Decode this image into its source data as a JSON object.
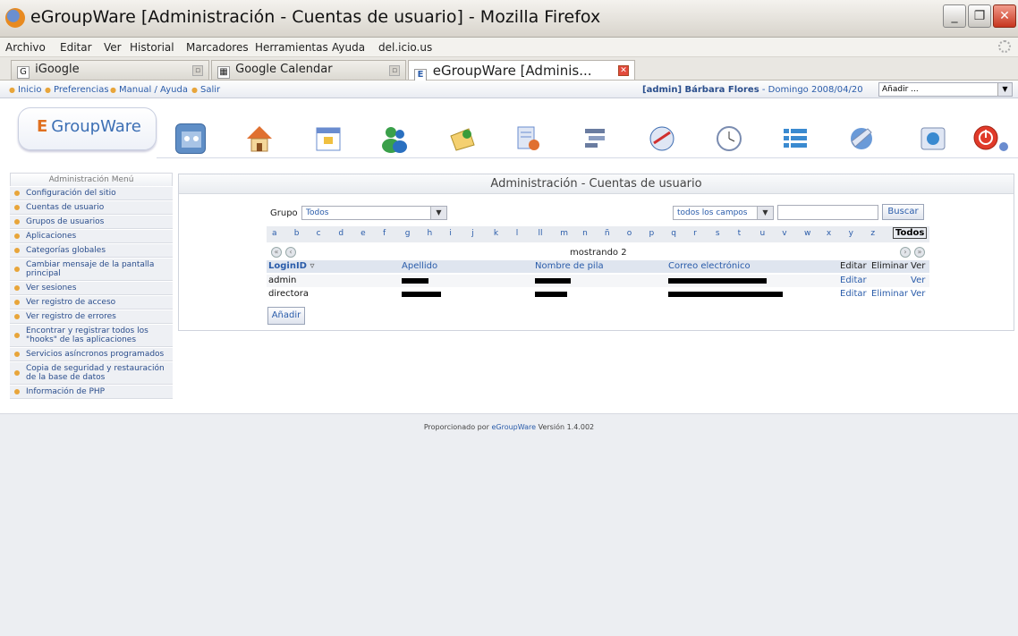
{
  "window": {
    "title": "eGroupWare [Administración - Cuentas de usuario] - Mozilla Firefox",
    "min_icon": "minimize-icon",
    "max_icon": "maximize-icon",
    "close_icon": "close-icon"
  },
  "menubar": {
    "items": [
      "Archivo",
      "Editar",
      "Ver",
      "Historial",
      "Marcadores",
      "Herramientas",
      "Ayuda",
      "del.icio.us"
    ]
  },
  "tabs": [
    {
      "label": "iGoogle",
      "favicon": "G"
    },
    {
      "label": "Google Calendar",
      "favicon": "▦"
    },
    {
      "label": "eGroupWare [Adminis...",
      "favicon": "E",
      "active": true
    }
  ],
  "egw_nav": {
    "links": [
      "Inicio",
      "Preferencias",
      "Manual / Ayuda",
      "Salir"
    ],
    "user": "[admin] Bárbara Flores",
    "date": " - Domingo 2008/04/20",
    "add_select": "Añadir ..."
  },
  "logo": {
    "e": "E",
    "text": "GroupWare"
  },
  "app_icons": [
    "admin-icon",
    "home-icon",
    "calendar-icon",
    "addressbook-icon",
    "email-icon",
    "notes-icon",
    "projects-icon",
    "infolog-icon",
    "timesheet-icon",
    "tracker-icon",
    "wiki-icon",
    "sitemgr-icon",
    "logout-icon"
  ],
  "sidebar": {
    "title": "Administración Menú",
    "items": [
      "Configuración del sitio",
      "Cuentas de usuario",
      "Grupos de usuarios",
      "Aplicaciones",
      "Categorías globales",
      "Cambiar mensaje de la pantalla principal",
      "Ver sesiones",
      "Ver registro de acceso",
      "Ver registro de errores",
      "Encontrar y registrar todos los \"hooks\" de las aplicaciones",
      "Servicios asíncronos programados",
      "Copia de seguridad y restauración de la base de datos",
      "Información de PHP"
    ]
  },
  "main": {
    "title": "Administración - Cuentas de usuario",
    "group_label": "Grupo",
    "group_value": "Todos",
    "field_value": "todos los campos",
    "search_value": "",
    "search_button": "Buscar",
    "letters": [
      "a",
      "b",
      "c",
      "d",
      "e",
      "f",
      "g",
      "h",
      "i",
      "j",
      "k",
      "l",
      "ll",
      "m",
      "n",
      "ñ",
      "o",
      "p",
      "q",
      "r",
      "s",
      "t",
      "u",
      "v",
      "w",
      "x",
      "y",
      "z"
    ],
    "letters_all": "Todos",
    "showing": "mostrando 2",
    "columns": {
      "login": "LoginID",
      "apellido": "Apellido",
      "nombre": "Nombre de pila",
      "correo": "Correo electrónico",
      "editar": "Editar",
      "eliminar": "Eliminar",
      "ver": "Ver"
    },
    "rows": [
      {
        "login": "admin",
        "editar": "Editar",
        "eliminar": "",
        "ver": "Ver"
      },
      {
        "login": "directora",
        "editar": "Editar",
        "eliminar": "Eliminar",
        "ver": "Ver"
      }
    ],
    "add_button": "Añadir"
  },
  "footer": {
    "prefix": "Proporcionado por ",
    "link": "eGroupWare",
    "suffix": " Versión 1.4.002"
  }
}
